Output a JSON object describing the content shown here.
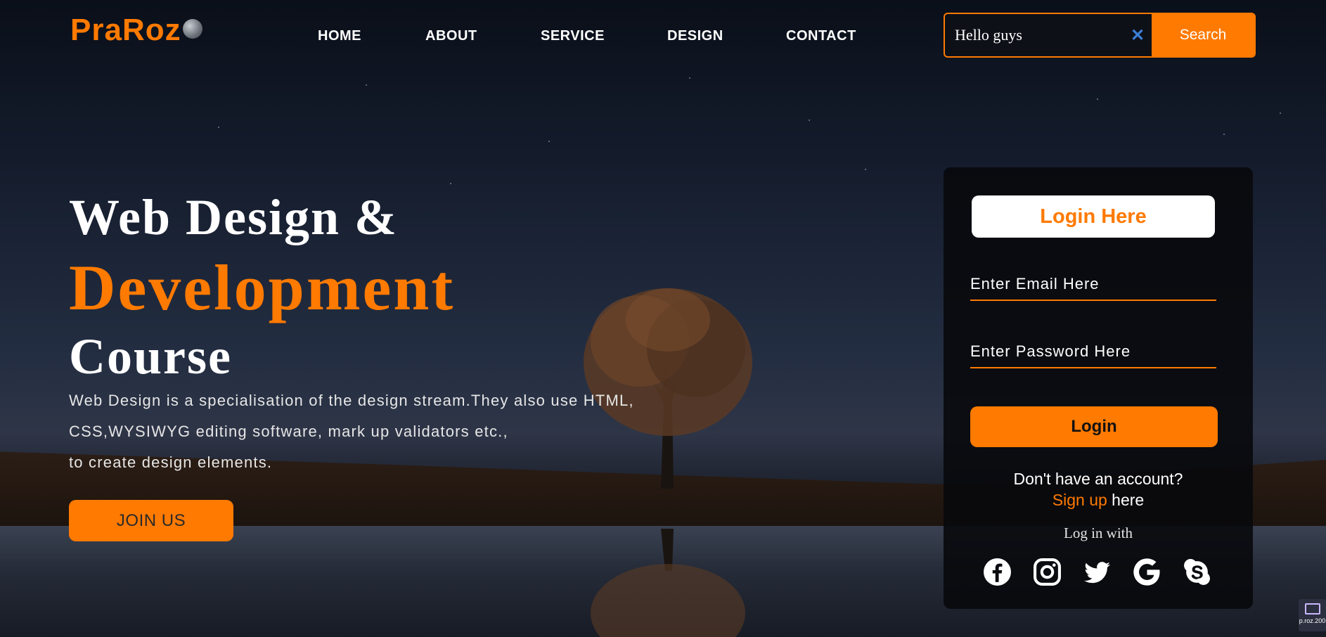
{
  "brand": {
    "name": "PraRoz"
  },
  "nav": {
    "items": [
      "HOME",
      "ABOUT",
      "SERVICE",
      "DESIGN",
      "CONTACT"
    ]
  },
  "search": {
    "value": "Hello guys",
    "clear_symbol": "✕",
    "button_label": "Search"
  },
  "hero": {
    "line1": "Web Design &",
    "line2": "Development",
    "line3": "Course",
    "description": [
      "Web Design is a specialisation of the design stream.They also use HTML,",
      "CSS,WYSIWYG editing software, mark up validators etc.,",
      "to create design elements."
    ],
    "cta_label": "JOIN US"
  },
  "login": {
    "title": "Login Here",
    "email_placeholder": "Enter Email Here",
    "password_placeholder": "Enter Password Here",
    "button_label": "Login",
    "no_account_text": "Don't have an account?",
    "signup_link": "Sign up",
    "signup_suffix": " here",
    "login_with": "Log in with",
    "social_icons": [
      "facebook-icon",
      "instagram-icon",
      "twitter-icon",
      "google-icon",
      "skype-icon"
    ]
  },
  "watermark": {
    "text": "p.roz.200"
  },
  "colors": {
    "accent": "#ff7a00",
    "text": "#ffffff",
    "card_bg": "#08090c",
    "search_clear": "#3d7fd6"
  }
}
